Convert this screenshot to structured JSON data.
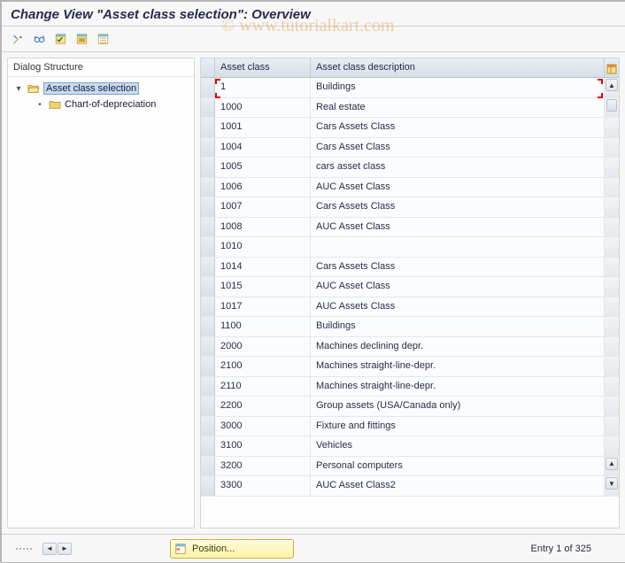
{
  "title": "Change View \"Asset class selection\": Overview",
  "watermark": "© www.tutorialkart.com",
  "toolbar": {
    "tooltips": [
      "Other view",
      "Change/Display",
      "Select all",
      "Select block",
      "Deselect all"
    ]
  },
  "tree": {
    "header": "Dialog Structure",
    "root": {
      "label": "Asset class selection",
      "expanded": true,
      "selected": true
    },
    "child": {
      "label": "Chart-of-depreciation"
    }
  },
  "table": {
    "columns": [
      "Asset class",
      "Asset class description"
    ],
    "rows": [
      {
        "code": "1",
        "desc": "Buildings"
      },
      {
        "code": "1000",
        "desc": "Real estate"
      },
      {
        "code": "1001",
        "desc": "Cars Assets Class"
      },
      {
        "code": "1004",
        "desc": "Cars Asset Class"
      },
      {
        "code": "1005",
        "desc": "cars asset class"
      },
      {
        "code": "1006",
        "desc": "AUC Asset Class"
      },
      {
        "code": "1007",
        "desc": "Cars Assets Class"
      },
      {
        "code": "1008",
        "desc": "AUC Asset Class"
      },
      {
        "code": "1010",
        "desc": ""
      },
      {
        "code": "1014",
        "desc": "Cars Assets Class"
      },
      {
        "code": "1015",
        "desc": "AUC Asset Class"
      },
      {
        "code": "1017",
        "desc": "AUC Assets Class"
      },
      {
        "code": "1100",
        "desc": "Buildings"
      },
      {
        "code": "2000",
        "desc": "Machines declining depr."
      },
      {
        "code": "2100",
        "desc": "Machines straight-line-depr."
      },
      {
        "code": "2110",
        "desc": "Machines straight-line-depr."
      },
      {
        "code": "2200",
        "desc": "Group assets (USA/Canada only)"
      },
      {
        "code": "3000",
        "desc": "Fixture and fittings"
      },
      {
        "code": "3100",
        "desc": "Vehicles"
      },
      {
        "code": "3200",
        "desc": "Personal computers"
      },
      {
        "code": "3300",
        "desc": "AUC Asset Class2"
      }
    ]
  },
  "footer": {
    "position_label": "Position...",
    "entry_status": "Entry 1 of 325"
  }
}
